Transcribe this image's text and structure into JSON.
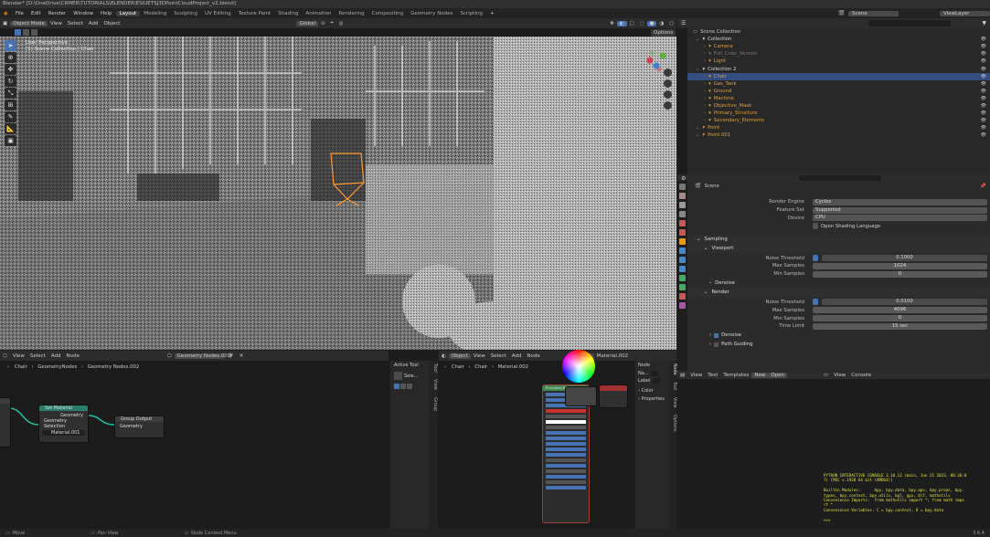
{
  "title_bar": "Blender* [D:\\OneDrive\\CRMER\\TUTORIALS\\BLENDER\\ESIUETSJ3DPointCloudProject_v2.blend]",
  "menu": [
    "File",
    "Edit",
    "Render",
    "Window",
    "Help"
  ],
  "workspaces": [
    "Layout",
    "Modeling",
    "Sculpting",
    "UV Editing",
    "Texture Paint",
    "Shading",
    "Animation",
    "Rendering",
    "Compositing",
    "Geometry Nodes",
    "Scripting"
  ],
  "scene": {
    "name": "Scene",
    "view_layer": "ViewLayer"
  },
  "viewport": {
    "mode": "Object Mode",
    "menus": [
      "View",
      "Select",
      "Add",
      "Object"
    ],
    "transform": "Global",
    "options": "Options",
    "perspective": "User Perspective",
    "collection_info": "(1) Scene Collection | Chair"
  },
  "outliner": {
    "title": "Scene Collection",
    "items": [
      {
        "label": "Collection",
        "indent": 1,
        "color": "#ddd"
      },
      {
        "label": "Camera",
        "indent": 2,
        "color": "#e0a040"
      },
      {
        "label": "Full_Color_Version",
        "indent": 2,
        "color": "#7a7a7a"
      },
      {
        "label": "Light",
        "indent": 2,
        "color": "#e0a040"
      },
      {
        "label": "Collection 2",
        "indent": 1,
        "color": "#ddd"
      },
      {
        "label": "Chair",
        "indent": 2,
        "color": "#e0a040",
        "selected": true
      },
      {
        "label": "Gas_Tank",
        "indent": 2,
        "color": "#e0a040"
      },
      {
        "label": "Ground",
        "indent": 2,
        "color": "#e0a040"
      },
      {
        "label": "Machine",
        "indent": 2,
        "color": "#e0a040"
      },
      {
        "label": "Objective_Mask",
        "indent": 2,
        "color": "#e0a040"
      },
      {
        "label": "Primary_Structure",
        "indent": 2,
        "color": "#e0a040"
      },
      {
        "label": "Secondary_Elements",
        "indent": 2,
        "color": "#e0a040"
      },
      {
        "label": "Point",
        "indent": 1,
        "color": "#e0a040"
      },
      {
        "label": "Point.001",
        "indent": 1,
        "color": "#e0a040"
      }
    ]
  },
  "properties": {
    "context": "Scene",
    "render_engine": {
      "label": "Render Engine",
      "value": "Cycles"
    },
    "feature_set": {
      "label": "Feature Set",
      "value": "Supported"
    },
    "device": {
      "label": "Device",
      "value": "CPU"
    },
    "osl": "Open Shading Language",
    "sampling": "Sampling",
    "viewport_section": "Viewport",
    "vp_noise_threshold": {
      "label": "Noise Threshold",
      "value": "0.1000"
    },
    "vp_max_samples": {
      "label": "Max Samples",
      "value": "1024"
    },
    "vp_min_samples": {
      "label": "Min Samples",
      "value": "0"
    },
    "denoise": "Denoise",
    "render_section": "Render",
    "r_noise_threshold": {
      "label": "Noise Threshold",
      "value": "0.0100"
    },
    "r_max_samples": {
      "label": "Max Samples",
      "value": "4096"
    },
    "r_min_samples": {
      "label": "Min Samples",
      "value": "0"
    },
    "r_time_limit": {
      "label": "Time Limit",
      "value": "15 sec"
    },
    "denoise2": "Denoise",
    "path_guiding": "Path Guiding"
  },
  "geo_editor": {
    "menus": [
      "View",
      "Select",
      "Add",
      "Node"
    ],
    "tree": "Geometry Nodes.002",
    "breadcrumb": [
      "Chair",
      "GeometryNodes",
      "Geometry Nodes.002"
    ],
    "set_material": {
      "title": "Set Material",
      "out": "Geometry",
      "in1": "Geometry",
      "in2": "Selection",
      "mat": "Material.001"
    },
    "group_output": {
      "title": "Group Output",
      "in": "Geometry"
    },
    "active_tool": "Active Tool",
    "tool_name": "Sele...",
    "side_tabs": [
      "Tool",
      "View",
      "Group"
    ]
  },
  "shader_editor": {
    "object": "Object",
    "menus": [
      "View",
      "Select",
      "Add",
      "Node"
    ],
    "slot": "Slot 1",
    "material": "Material.002",
    "breadcrumb": [
      "Chair",
      "Chair",
      "Material.002"
    ],
    "node_panel": {
      "title": "Node",
      "name": "Na...",
      "label": "Label",
      "color": "Color",
      "properties": "Properties"
    },
    "side_tabs": [
      "Node",
      "Tool",
      "View",
      "Options"
    ],
    "bsdf_title": "Principled BSDF"
  },
  "text_editor": {
    "menus": [
      "View",
      "Text",
      "Templates"
    ],
    "new": "New",
    "open": "Open"
  },
  "console": {
    "menus": [
      "View",
      "Console"
    ],
    "lines": [
      "PYTHON INTERACTIVE CONSOLE 3.10.12 (main, Jun 21 2023, 08:36:0",
      "7) [MSC v.1928 64 bit (AMD64)]",
      "",
      "Builtin Modules:      bpy, bpy.data, bpy.ops, bpy.props, bpy.",
      "types, bpy.context, bpy.utils, bgl, gpu, blf, mathutils",
      "Convenience Imports:  from mathutils import *; from math impo",
      "rt *",
      "Convenience Variables: C = bpy.context, D = bpy.data",
      "",
      ">>> "
    ]
  },
  "status": {
    "left": "Move",
    "mid": "Pan View",
    "right": "Node Context Menu",
    "version": "3.6.4"
  }
}
